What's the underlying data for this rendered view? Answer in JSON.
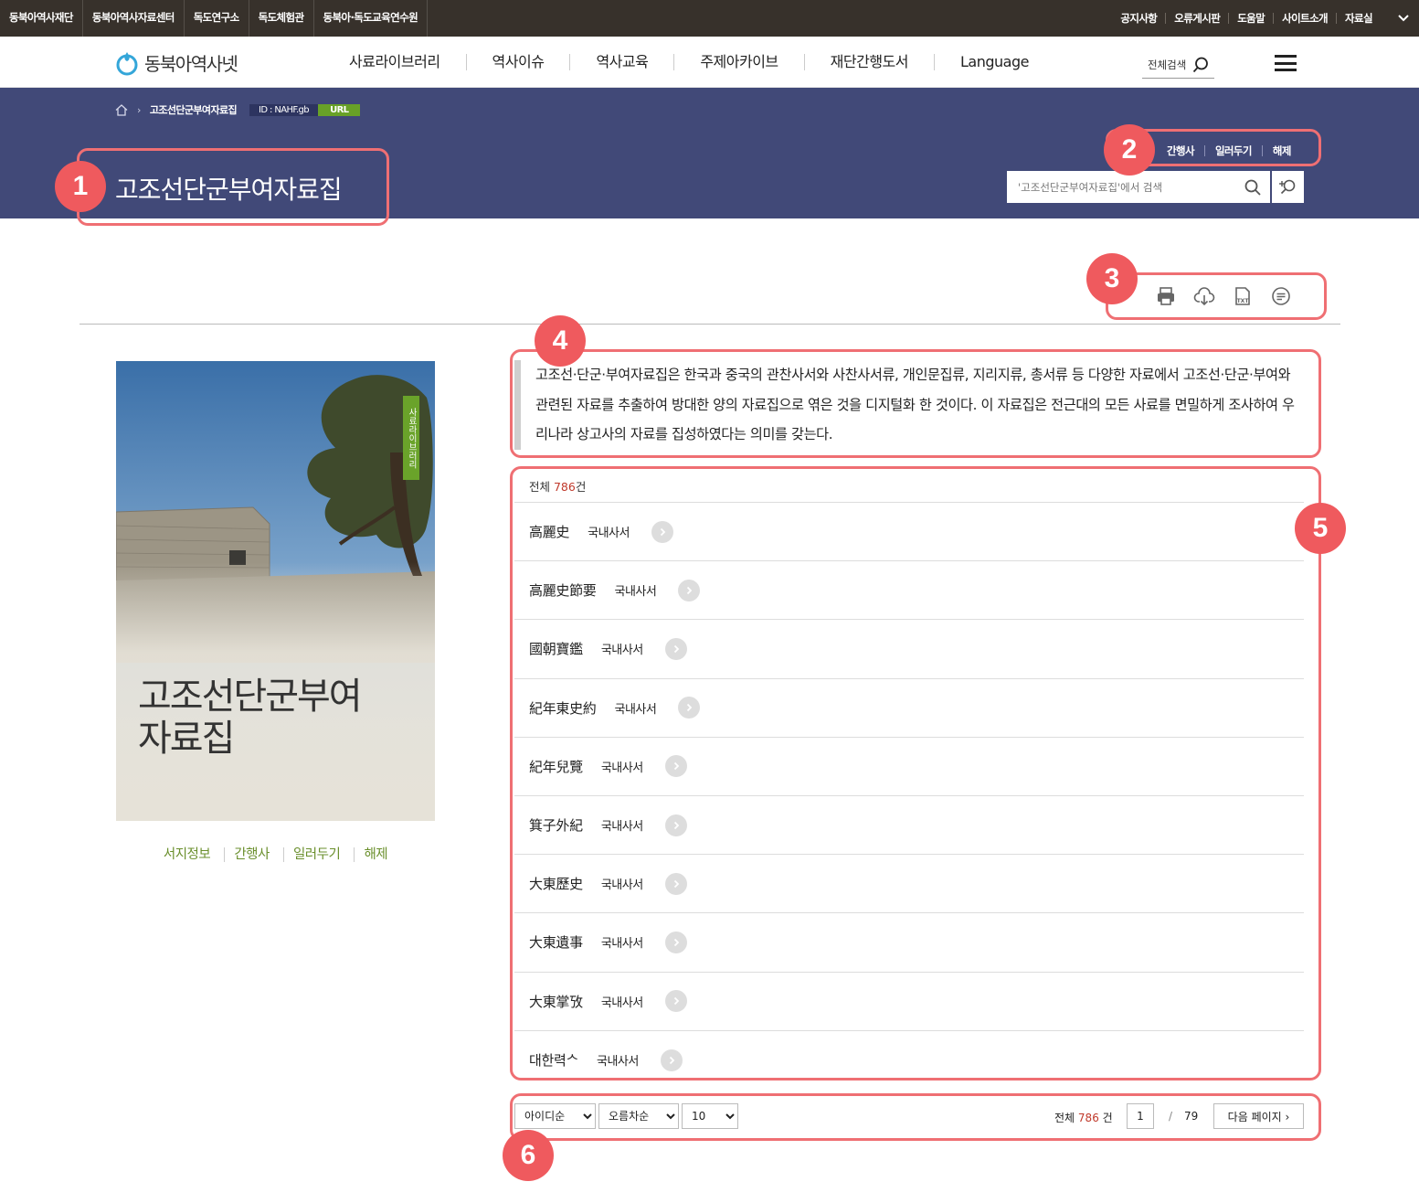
{
  "topbar": {
    "sites": [
      "동북아역사재단",
      "동북아역사자료센터",
      "독도연구소",
      "독도체험관",
      "동북아·독도교육연수원"
    ],
    "utils": [
      "공지사항",
      "오류게시판",
      "도움말",
      "사이트소개",
      "자료실"
    ]
  },
  "header": {
    "logo_text": "동북아역사넷",
    "nav": [
      "사료라이브러리",
      "역사이슈",
      "역사교육",
      "주제아카이브",
      "재단간행도서",
      "Language"
    ],
    "search_label": "전체검색"
  },
  "band": {
    "breadcrumb": "고조선단군부여자료집",
    "id_badge": "ID : NAHF.gb",
    "url_badge": "URL",
    "title": "고조선단군부여자료집",
    "links": [
      "간행사",
      "일러두기",
      "해제"
    ],
    "search_placeholder": "'고조선단군부여자료집'에서 검색"
  },
  "book": {
    "cover_title_line1": "고조선단군부여",
    "cover_title_line2": "자료집",
    "cover_badge": "사료라이브러리",
    "links": [
      "서지정보",
      "간행사",
      "일러두기",
      "해제"
    ]
  },
  "description": "고조선·단군·부여자료집은 한국과 중국의 관찬사서와 사찬사서류, 개인문집류, 지리지류, 총서류 등 다양한 자료에서 고조선·단군·부여와 관련된 자료를 추출하여 방대한 양의 자료집으로 엮은 것을 디지털화 한 것이다. 이 자료집은 전근대의 모든 사료를 면밀하게 조사하여 우리나라 상고사의 자료를 집성하였다는 의미를 갖는다.",
  "list": {
    "total_prefix": "전체 ",
    "total_num": "786",
    "total_suffix": "건",
    "items": [
      {
        "title": "高麗史",
        "category": "국내사서"
      },
      {
        "title": "高麗史節要",
        "category": "국내사서"
      },
      {
        "title": "國朝寶鑑",
        "category": "국내사서"
      },
      {
        "title": "紀年東史約",
        "category": "국내사서"
      },
      {
        "title": "紀年兒覽",
        "category": "국내사서"
      },
      {
        "title": "箕子外紀",
        "category": "국내사서"
      },
      {
        "title": "大東歷史",
        "category": "국내사서"
      },
      {
        "title": "大東遺事",
        "category": "국내사서"
      },
      {
        "title": "大東掌攷",
        "category": "국내사서"
      },
      {
        "title": "대한력ᄉ",
        "category": "국내사서"
      }
    ]
  },
  "pager": {
    "sort_options": [
      "아이디순"
    ],
    "order_options": [
      "오름차순"
    ],
    "size_options": [
      "10"
    ],
    "total_prefix": "전체",
    "total_num": "786",
    "total_suffix": "건",
    "current_page": "1",
    "slash": "/",
    "page_total": "79",
    "next_label": "다음 페이지"
  },
  "callouts": [
    "1",
    "2",
    "3",
    "4",
    "5",
    "6"
  ],
  "colors": {
    "band": "#414978",
    "callout": "#ef5a5e",
    "accent_green": "#6aa32a",
    "count_red": "#c0392b"
  }
}
